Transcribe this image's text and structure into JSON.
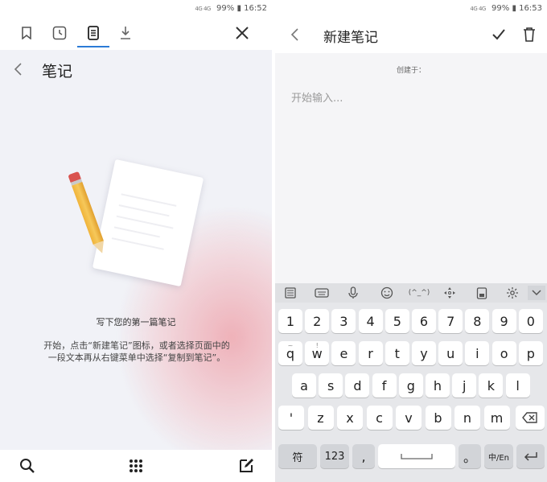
{
  "left": {
    "status": {
      "signal": "4G 4G",
      "battery": "99%",
      "time": "16:52"
    },
    "tabs": [
      {
        "icon": "bookmark-icon"
      },
      {
        "icon": "history-icon"
      },
      {
        "icon": "notes-icon"
      },
      {
        "icon": "download-icon"
      }
    ],
    "close_icon": "close-icon",
    "header": {
      "title": "笔记"
    },
    "empty_state": {
      "title": "写下您的第一篇笔记",
      "description": "开始，点击“新建笔记”图标，或者选择页面中的一段文本再从右键菜单中选择“复制到笔记”。"
    },
    "bottom_bar": [
      {
        "icon": "search-icon"
      },
      {
        "icon": "grid-menu-icon"
      },
      {
        "icon": "edit-note-icon"
      }
    ]
  },
  "right": {
    "status": {
      "signal": "4G 4G",
      "battery": "99%",
      "time": "16:53"
    },
    "header": {
      "title": "新建笔记"
    },
    "created_label": "创建于：",
    "note_placeholder": "开始输入...",
    "keyboard": {
      "toolbar": [
        "keyboard-layout-icon",
        "keyboard-icon",
        "microphone-icon",
        "emoji-icon",
        "(^_^)",
        "cursor-move-icon",
        "clipboard-icon",
        "settings-icon",
        "collapse-icon"
      ],
      "row_numbers": [
        "1",
        "2",
        "3",
        "4",
        "5",
        "6",
        "7",
        "8",
        "9",
        "0"
      ],
      "row1": [
        {
          "k": "q",
          "s": "~"
        },
        {
          "k": "w",
          "s": "!"
        },
        {
          "k": "e",
          "s": ""
        },
        {
          "k": "r",
          "s": ""
        },
        {
          "k": "t",
          "s": ""
        },
        {
          "k": "y",
          "s": ""
        },
        {
          "k": "u",
          "s": ""
        },
        {
          "k": "i",
          "s": ""
        },
        {
          "k": "o",
          "s": ""
        },
        {
          "k": "p",
          "s": ""
        }
      ],
      "row2": [
        "a",
        "s",
        "d",
        "f",
        "g",
        "h",
        "j",
        "k",
        "l"
      ],
      "row3": [
        "'",
        "z",
        "x",
        "c",
        "v",
        "b",
        "n",
        "m"
      ],
      "bottom": {
        "symbols": "符",
        "numbers": "123",
        "comma": ",",
        "period": "。",
        "lang": "中/En"
      }
    }
  }
}
